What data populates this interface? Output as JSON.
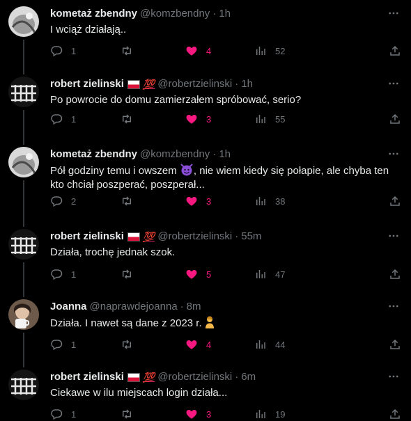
{
  "colors": {
    "like": "#f91880",
    "muted": "#71767b",
    "text": "#e7e9ea",
    "bg": "#000000",
    "flag_red": "#dc143c"
  },
  "icons": {
    "reply": "speech-bubble-icon",
    "retweet": "retweet-icon",
    "like": "heart-icon",
    "views": "bar-chart-icon",
    "share": "share-icon",
    "more": "more-icon"
  },
  "tweets": [
    {
      "name": "kometaż zbendny",
      "handle": "@komzbendny",
      "time": "1h",
      "text": "I wciąż działają..",
      "replies": "1",
      "likes": "4",
      "views": "52"
    },
    {
      "name": "robert zielinski",
      "handle": "@robertzielinski",
      "time": "1h",
      "text": "Po powrocie do domu zamierzałem spróbować, serio?",
      "replies": "1",
      "likes": "3",
      "views": "55"
    },
    {
      "name": "kometaż zbendny",
      "handle": "@komzbendny",
      "time": "1h",
      "text_a": "Pół godziny temu i owszem",
      "text_b": ", nie wiem kiedy się połapie,  ale chyba ten kto chciał poszperać,  poszperał...",
      "replies": "2",
      "likes": "3",
      "views": "38"
    },
    {
      "name": "robert zielinski",
      "handle": "@robertzielinski",
      "time": "55m",
      "text": "Działa, trochę jednak szok.",
      "replies": "1",
      "likes": "5",
      "views": "47"
    },
    {
      "name": "Joanna",
      "handle": "@naprawdejoanna",
      "time": "8m",
      "text": "Działa. I nawet są dane z 2023 r.",
      "replies": "1",
      "likes": "4",
      "views": "44"
    },
    {
      "name": "robert zielinski",
      "handle": "@robertzielinski",
      "time": "6m",
      "text": "Ciekawe w ilu miejscach login działa...",
      "replies": "1",
      "likes": "3",
      "views": "19"
    }
  ],
  "badge_100": "💯",
  "separator": "·"
}
